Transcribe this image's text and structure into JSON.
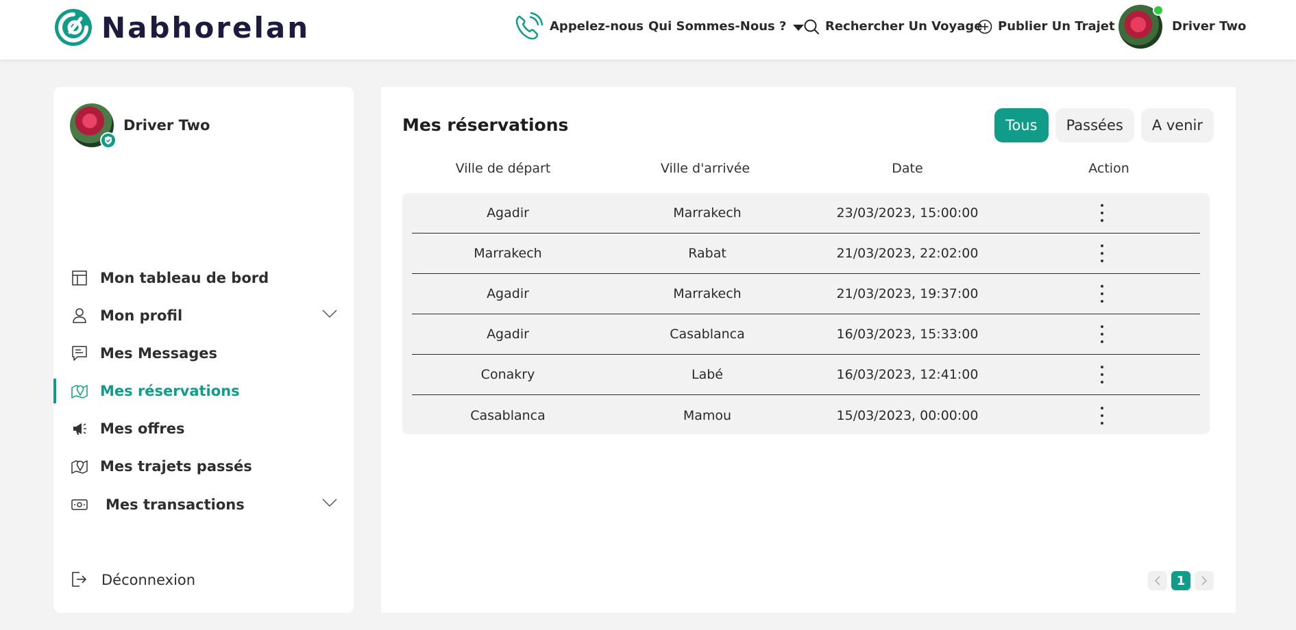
{
  "brand": {
    "name": "Nabhorelan",
    "accent": "#119c8a"
  },
  "header": {
    "call_label": "Appelez-nous",
    "about_label": "Qui Sommes-Nous ?",
    "search_label": "Rechercher Un Voyage",
    "publish_label": "Publier Un Trajet",
    "user_name": "Driver Two"
  },
  "sidebar": {
    "user_name": "Driver Two",
    "items": [
      {
        "label": "Mon tableau de bord",
        "icon": "dashboard-icon"
      },
      {
        "label": "Mon profil",
        "icon": "user-icon"
      },
      {
        "label": "Mes Messages",
        "icon": "message-icon"
      },
      {
        "label": "Mes réservations",
        "icon": "map-pin-icon"
      },
      {
        "label": "Mes offres",
        "icon": "megaphone-icon"
      },
      {
        "label": "Mes trajets passés",
        "icon": "map-pin-icon"
      },
      {
        "label": "Mes transactions",
        "icon": "money-icon"
      }
    ],
    "active_index": 3,
    "logout_label": "Déconnexion"
  },
  "main": {
    "title": "Mes réservations",
    "filters": [
      "Tous",
      "Passées",
      "A venir"
    ],
    "active_filter": 0,
    "columns": [
      "Ville de départ",
      "Ville d'arrivée",
      "Date",
      "Action"
    ],
    "rows": [
      {
        "from": "Agadir",
        "to": "Marrakech",
        "date": "23/03/2023, 15:00:00"
      },
      {
        "from": "Marrakech",
        "to": "Rabat",
        "date": "21/03/2023, 22:02:00"
      },
      {
        "from": "Agadir",
        "to": "Marrakech",
        "date": "21/03/2023, 19:37:00"
      },
      {
        "from": "Agadir",
        "to": "Casablanca",
        "date": "16/03/2023, 15:33:00"
      },
      {
        "from": "Conakry",
        "to": "Labé",
        "date": "16/03/2023, 12:41:00"
      },
      {
        "from": "Casablanca",
        "to": "Mamou",
        "date": "15/03/2023, 00:00:00"
      }
    ],
    "pagination": {
      "current_page": "1"
    }
  }
}
